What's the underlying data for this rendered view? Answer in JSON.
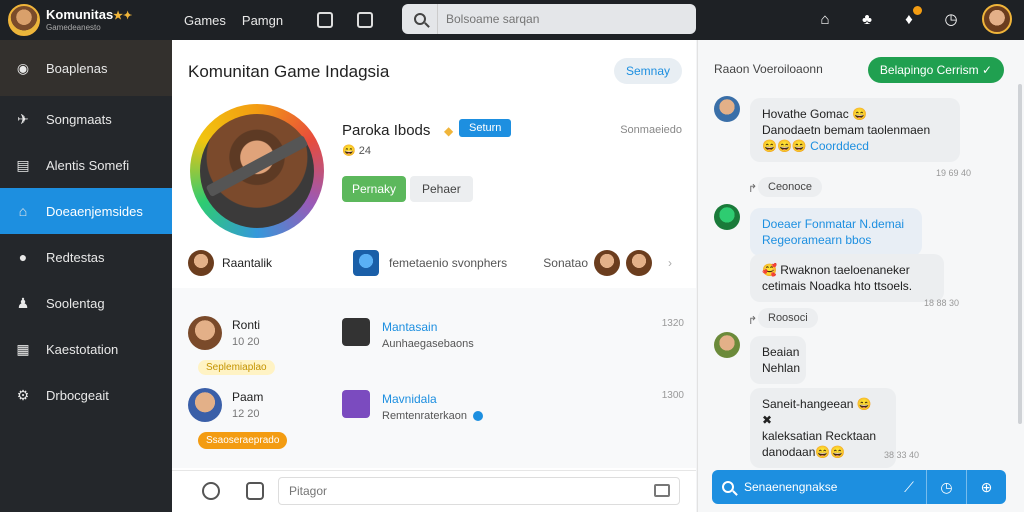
{
  "topbar": {
    "brand": "Komunitas",
    "brand_badge": "★✦",
    "brand_sub": "Gamedeanesto",
    "nav": [
      "Games",
      "Pamgn"
    ],
    "search_placeholder": "Bolsoame sarqan"
  },
  "sidebar": {
    "items": [
      {
        "label": "Boaplenas",
        "icon": "home-circle-icon"
      },
      {
        "label": "Songmaats",
        "icon": "bird-icon"
      },
      {
        "label": "Alentis Somefi",
        "icon": "document-icon"
      },
      {
        "label": "Doeaenjemsides",
        "icon": "home-icon"
      },
      {
        "label": "Redtestas",
        "icon": "chat-bubble-icon"
      },
      {
        "label": "Soolentag",
        "icon": "users-icon"
      },
      {
        "label": "Kaestotation",
        "icon": "keyboard-icon"
      },
      {
        "label": "Drbocgeait",
        "icon": "settings-icon"
      }
    ],
    "active_index": 3
  },
  "main": {
    "title": "Komunitan Game Indagsia",
    "top_button": "Semnay",
    "profile": {
      "name": "Paroka Ibods",
      "badge": "Seturn",
      "sub": "24",
      "meta": "Sonmaeiedo",
      "primary_button": "Pernaky",
      "secondary_button": "Pehaer"
    },
    "friends": {
      "left_label": "Raantalik",
      "center_label": "femetaenio svonphers",
      "right_label": "Sonatao"
    },
    "feed": [
      {
        "name": "Ronti",
        "time": "10 20",
        "title": "Mantasain",
        "desc": "Aunhaegasebaons",
        "stamp": "1320",
        "tag": "Seplemiaplao"
      },
      {
        "name": "Paam",
        "time": "12 20",
        "title": "Mavnidala",
        "desc": "Remtenraterkaon",
        "stamp": "1300",
        "tag": "Ssaoseraeprado"
      }
    ],
    "composer_placeholder": "Pitagor"
  },
  "chat": {
    "header": "Raaon Voeroiloaonn",
    "header_button": "Belapingo Cerrism",
    "messages": [
      {
        "line1": "Hovathe Gomac 😄",
        "line2": "Danodaetn bemam taolenmaen",
        "line3_emoji": "😄😄😄",
        "line3_link": "Coorddecd",
        "meta": "19 69 40"
      },
      {
        "reply": "Ceonoce"
      },
      {
        "line1": "Doeaer Fonmatar N.demai",
        "line2": "Regeoramearn bbos",
        "line3": "🥰 Rwaknon taeloenaneker",
        "line4": "cetimais Noadka hto ttsoels.",
        "meta": "18 88 30"
      },
      {
        "reply": "Roosoci"
      },
      {
        "line1": "Beaian",
        "line2": "Nehlan"
      },
      {
        "line1": "Saneit-hangeean 😄 ✖",
        "line2": "kaleksatian Recktaan",
        "line3": "danodaan😄😄",
        "meta": "38 33 40"
      }
    ],
    "footer_search": "Senaenengnakse"
  }
}
